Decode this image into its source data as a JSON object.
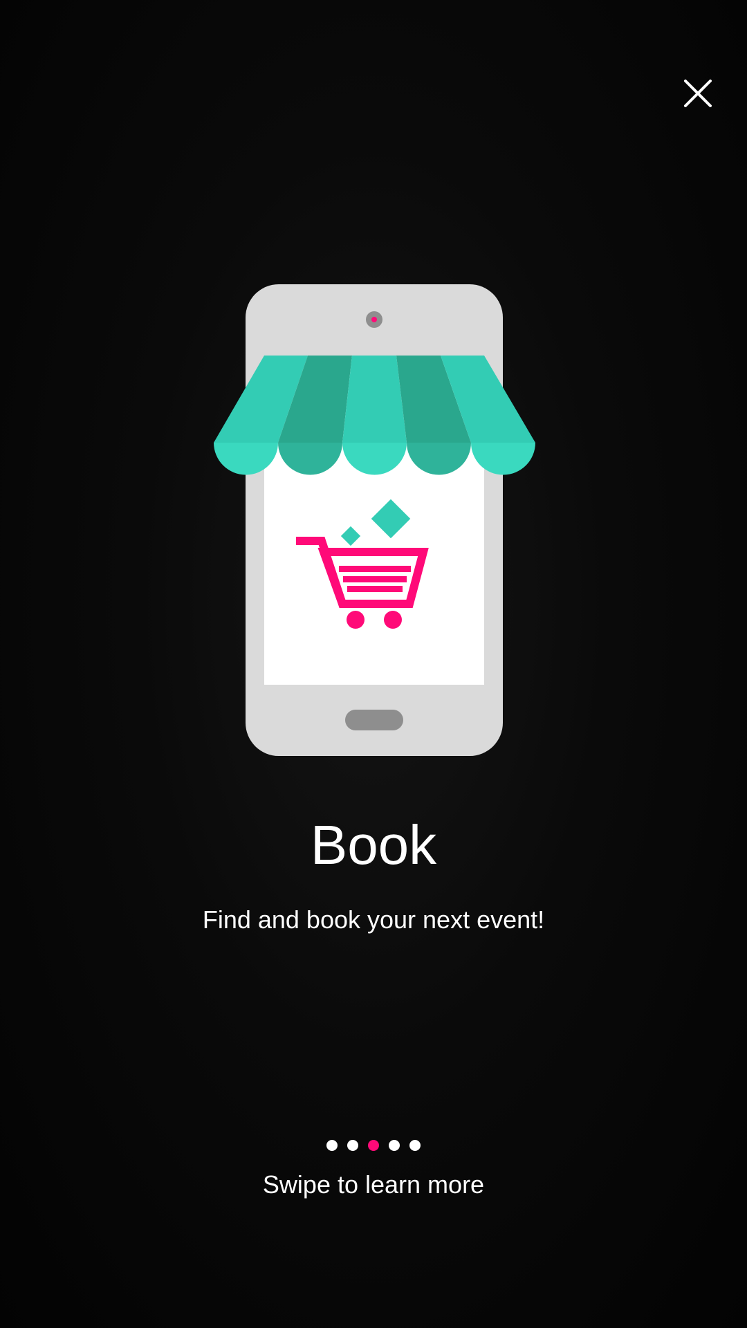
{
  "header": {
    "close_icon": "close-icon"
  },
  "illustration": {
    "icon": "storefront-phone-cart-illustration",
    "colors": {
      "phone_body": "#dadada",
      "screen": "#ffffff",
      "awning_light": "#33ccb4",
      "awning_dark": "#2aa78d",
      "awning_scallop": "#3ad9bf",
      "cart": "#ff0a78"
    }
  },
  "content": {
    "title": "Book",
    "subtitle": "Find and book your next event!"
  },
  "pager": {
    "total": 5,
    "active_index": 2,
    "active_color": "#ff0a78",
    "inactive_color": "#ffffff"
  },
  "footer": {
    "hint": "Swipe to learn more"
  }
}
